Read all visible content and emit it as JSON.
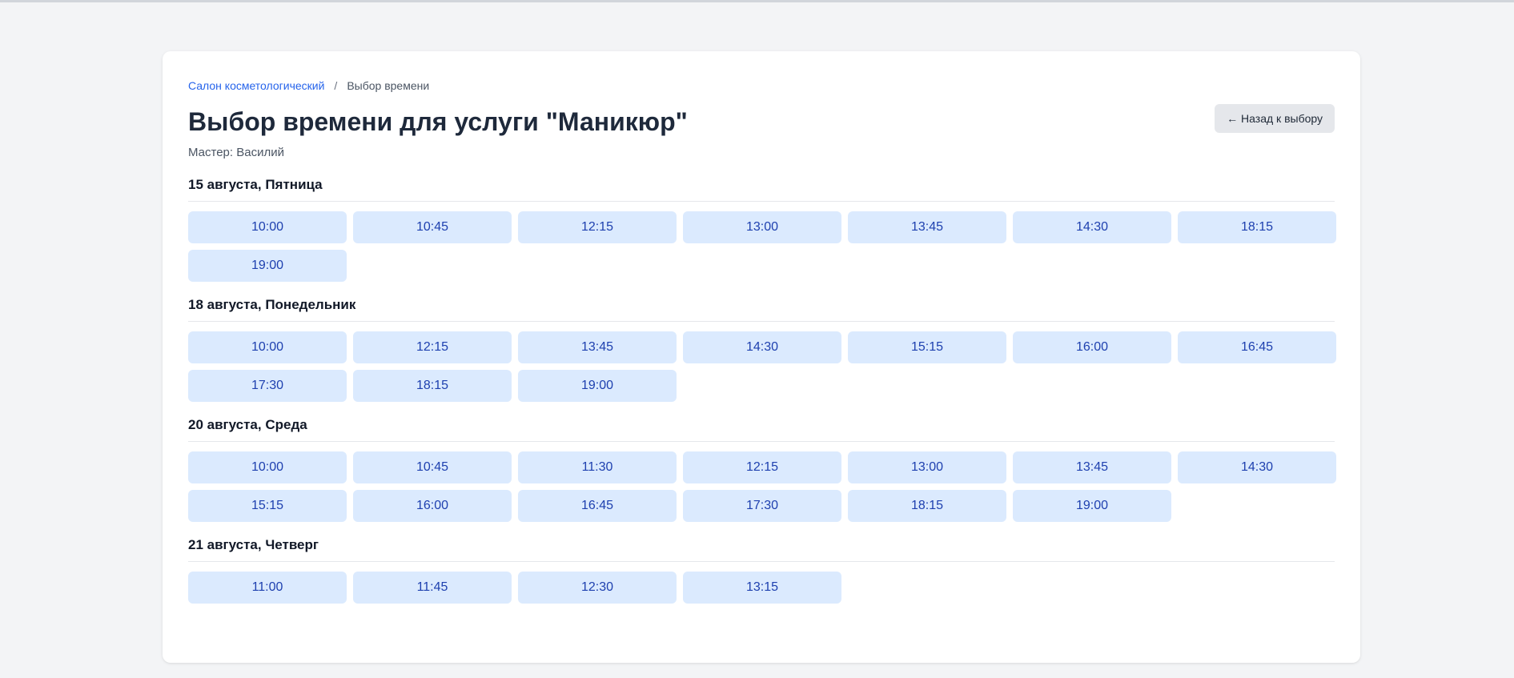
{
  "breadcrumb": {
    "salon": "Салон косметологический",
    "separator": "/",
    "current": "Выбор времени"
  },
  "page": {
    "title": "Выбор времени для услуги \"Маникюр\"",
    "master": "Мастер: Василий",
    "back_label": "← Назад к выбору"
  },
  "days": [
    {
      "title": "15 августа, Пятница",
      "slots": [
        "10:00",
        "10:45",
        "12:15",
        "13:00",
        "13:45",
        "14:30",
        "18:15",
        "19:00"
      ]
    },
    {
      "title": "18 августа, Понедельник",
      "slots": [
        "10:00",
        "12:15",
        "13:45",
        "14:30",
        "15:15",
        "16:00",
        "16:45",
        "17:30",
        "18:15",
        "19:00"
      ]
    },
    {
      "title": "20 августа, Среда",
      "slots": [
        "10:00",
        "10:45",
        "11:30",
        "12:15",
        "13:00",
        "13:45",
        "14:30",
        "15:15",
        "16:00",
        "16:45",
        "17:30",
        "18:15",
        "19:00"
      ]
    },
    {
      "title": "21 августа, Четверг",
      "slots": [
        "11:00",
        "11:45",
        "12:30",
        "13:15"
      ]
    }
  ]
}
